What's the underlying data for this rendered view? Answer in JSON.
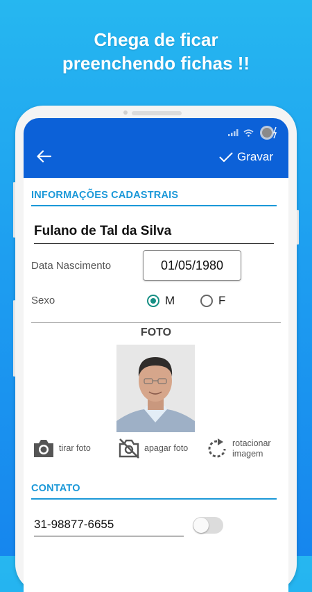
{
  "headline": {
    "line1": "Chega de ficar",
    "line2": "preenchendo fichas !!"
  },
  "appbar": {
    "save_label": "Gravar",
    "color": "#0c61d8"
  },
  "section_cadastro": {
    "title": "INFORMAÇÕES CADASTRAIS"
  },
  "form": {
    "name_value": "Fulano de Tal da Silva",
    "birth_label": "Data Nascimento",
    "birth_value": "01/05/1980",
    "sex_label": "Sexo",
    "sex_options": [
      {
        "label": "M",
        "selected": true
      },
      {
        "label": "F",
        "selected": false
      }
    ]
  },
  "photo_section": {
    "title": "FOTO",
    "actions": {
      "take": "tirar foto",
      "delete": "apagar foto",
      "rotate_line1": "rotacionar",
      "rotate_line2": "imagem"
    }
  },
  "section_contato": {
    "title": "CONTATO"
  },
  "contact": {
    "phone_value": "31-98877-6655",
    "toggle_on": false
  },
  "colors": {
    "accent": "#1b98d8",
    "radio": "#178f84",
    "background_top": "#26b7f0",
    "background_bottom": "#1686ee"
  },
  "icons": [
    "wifi-icon",
    "signal-icon",
    "battery-icon",
    "back-arrow-icon",
    "check-icon",
    "camera-icon",
    "camera-off-icon",
    "rotate-icon"
  ]
}
